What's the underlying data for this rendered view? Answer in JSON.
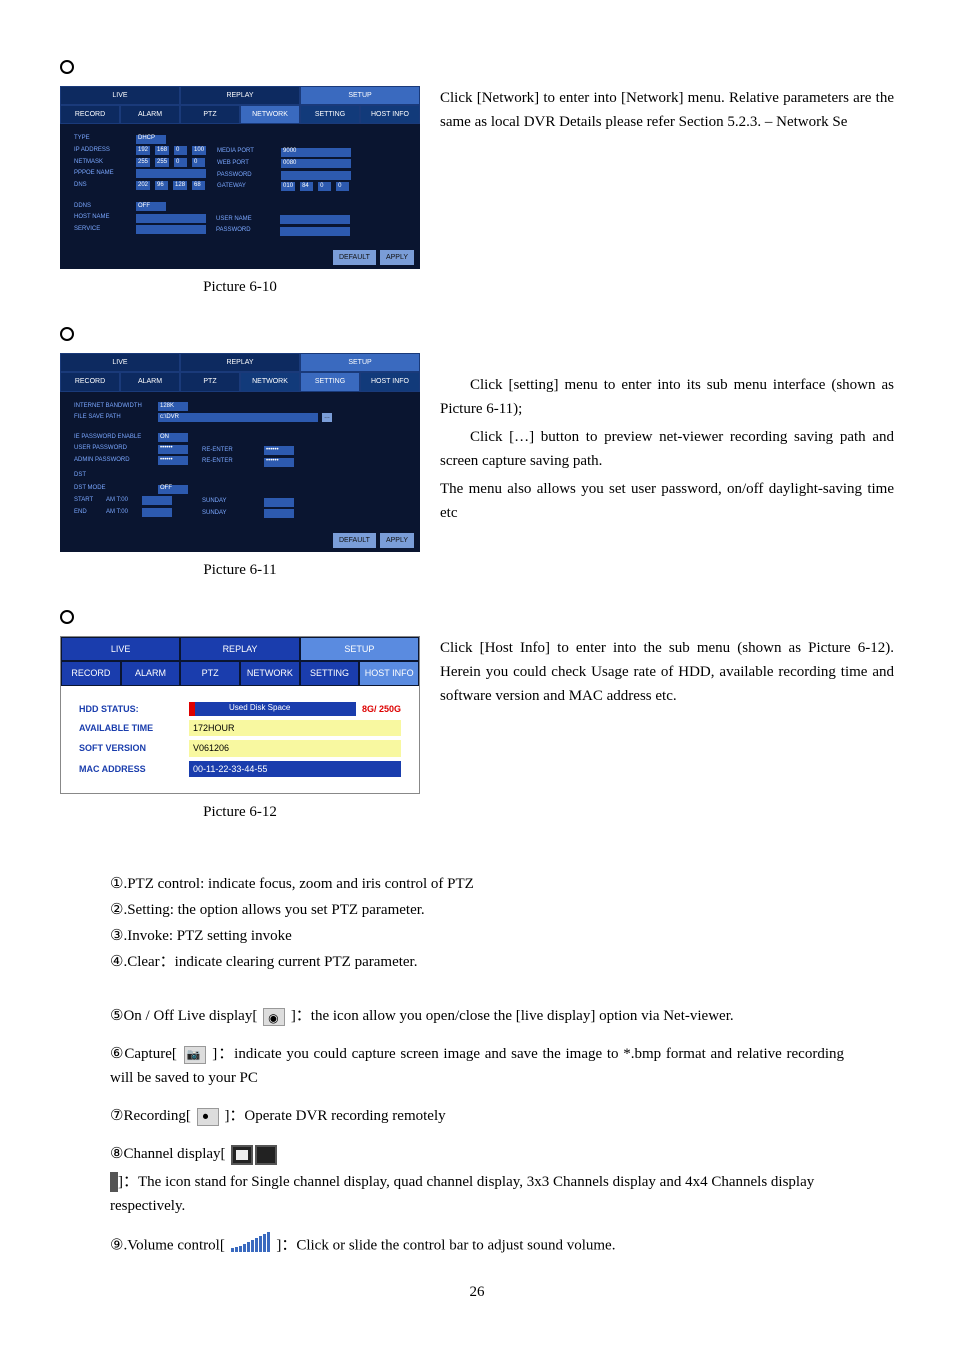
{
  "pic610": {
    "bullet": true,
    "tabs_top": [
      "LIVE",
      "REPLAY",
      "SETUP"
    ],
    "tabs_sub": [
      "RECORD",
      "ALARM",
      "PTZ",
      "NETWORK",
      "SETTING",
      "HOST INFO"
    ],
    "active_sub_idx": 3,
    "left_fields": {
      "type_label": "TYPE",
      "type_val": "DHCP",
      "ip_label": "IP ADDRESS",
      "ip": [
        "192",
        "168",
        "0",
        "100"
      ],
      "mask_label": "NETMASK",
      "mask": [
        "255",
        "255",
        "0",
        "0"
      ],
      "pppoe_label": "PPPOE NAME",
      "pppoe_val": "",
      "dns_label": "DNS",
      "dns": [
        "202",
        "96",
        "128",
        "68"
      ]
    },
    "mid_fields": {
      "media_label": "MEDIA PORT",
      "media_val": "9000",
      "web_label": "WEB PORT",
      "web_val": "0080",
      "pw_label": "PASSWORD",
      "pw_val": "",
      "gw_label": "GATEWAY",
      "gw": [
        "010",
        "84",
        "0",
        "0"
      ]
    },
    "bottom": {
      "ddns_label": "DDNS",
      "ddns_val": "OFF",
      "host_label": "HOST NAME",
      "host_val": "",
      "service_label": "SERVICE",
      "service_val": "",
      "user_label": "USER NAME",
      "user_val": "",
      "pw2_label": "PASSWORD",
      "pw2_val": ""
    },
    "buttons": [
      "DEFAULT",
      "APPLY"
    ],
    "caption": "Picture 6-10",
    "desc1": "Click [Network] to enter into [Network] menu. Relative parameters are the same as local DVR Details please refer Section 5.2.3. – Network Se"
  },
  "pic611": {
    "tabs_top": [
      "LIVE",
      "REPLAY",
      "SETUP"
    ],
    "tabs_sub": [
      "RECORD",
      "ALARM",
      "PTZ",
      "NETWORK",
      "SETTING",
      "HOST INFO"
    ],
    "active_sub_idx": 4,
    "fields": {
      "bw_label": "INTERNET BANDWIDTH",
      "bw_val": "128K",
      "path_label": "FILE SAVE PATH",
      "path_val": "c:\\DVR",
      "path_btn": "…",
      "pwen_label": "IE PASSWORD ENABLE",
      "pwen_val": "ON",
      "upw_label": "USER PASSWORD",
      "upw_val": "••••••",
      "re1_label": "RE-ENTER",
      "re1_val": "••••••",
      "apw_label": "ADMIN PASSWORD",
      "apw_val": "••••••",
      "re2_label": "RE-ENTER",
      "re2_val": "••••••",
      "dst_label": "DST",
      "dst_mode_label": "DST MODE",
      "dst_mode_val": "OFF",
      "start_label": "START",
      "start_ampm": "AM T:00",
      "start_val": "",
      "start_day_label": "SUNDAY",
      "start_day_val": "",
      "end_label": "END",
      "end_ampm": "AM T:00",
      "end_val": "",
      "end_day_label": "SUNDAY",
      "end_day_val": ""
    },
    "buttons": [
      "DEFAULT",
      "APPLY"
    ],
    "caption": "Picture 6-11",
    "desc1": "Click [setting] menu to enter into its sub menu interface (shown as Picture 6-11);",
    "desc2": "Click […] button to preview net-viewer recording saving path and screen capture saving path.",
    "desc3": "The menu also allows you set user password, on/off daylight-saving time etc"
  },
  "pic612": {
    "tabs_top": [
      "LIVE",
      "REPLAY",
      "SETUP"
    ],
    "tabs_sub": [
      "RECORD",
      "ALARM",
      "PTZ",
      "NETWORK",
      "SETTING",
      "HOST INFO"
    ],
    "active_sub_idx": 5,
    "hdd_label": "HDD STATUS:",
    "hdd_bar_text": "Used Disk Space",
    "hdd_total": "8G/ 250G",
    "avail_label": "AVAILABLE TIME",
    "avail_val": "172HOUR",
    "ver_label": "SOFT VERSION",
    "ver_val": "V061206",
    "mac_label": "MAC ADDRESS",
    "mac_val": "00-11-22-33-44-55",
    "caption": "Picture 6-12",
    "desc1": "Click [Host Info] to enter into the sub menu (shown as Picture 6-12). Herein you could check Usage rate of HDD, available recording time and software version and MAC address etc."
  },
  "list": {
    "i1": "①.PTZ control: indicate focus, zoom and iris control of PTZ",
    "i2": "②.Setting: the option allows you set PTZ parameter.",
    "i3": "③.Invoke: PTZ setting invoke",
    "i4": "④.Clear：indicate clearing current PTZ parameter."
  },
  "notes": {
    "n5a": "⑤On / Off Live display[",
    "n5b": "]：the icon allow you open/close the [live display] option via Net-viewer.",
    "n6a": "⑥Capture[",
    "n6b": "]：indicate you could capture screen image and save the image to *.bmp format and relative recording will be saved to your PC",
    "n7a": "⑦Recording[",
    "n7b": "]：Operate DVR recording remotely",
    "n8a": "⑧Channel display[",
    "n8b": "]：The icon stand for Single channel display, quad channel display, 3x3 Channels display and 4x4 Channels display respectively.",
    "n9a": "⑨.Volume control[",
    "n9b": "]：Click or slide the control bar to adjust sound volume."
  },
  "page_num": "26"
}
